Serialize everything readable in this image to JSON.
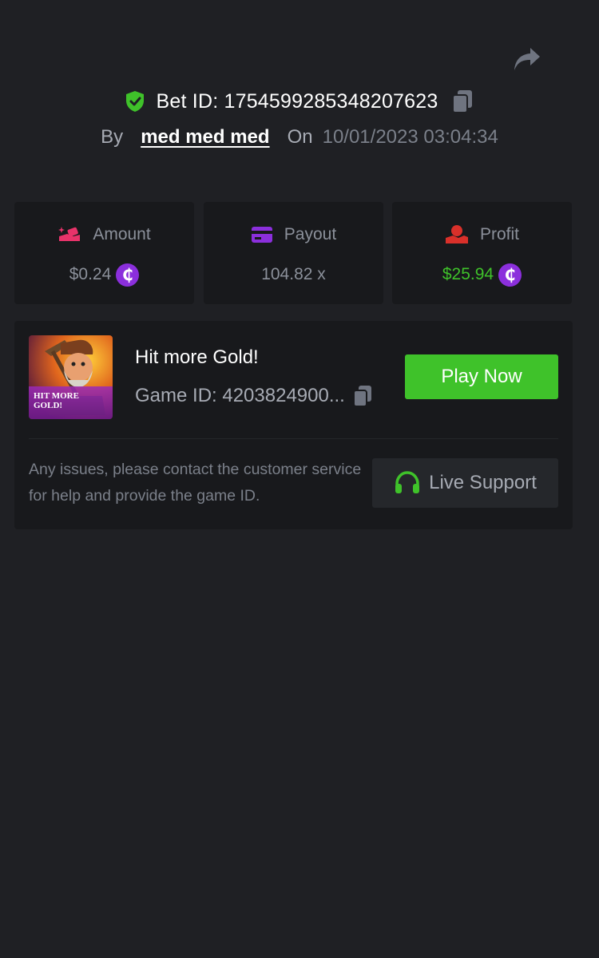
{
  "header": {
    "bet_id": "Bet ID: 1754599285348207623",
    "by_label": "By",
    "username": "med med med",
    "on_label": "On",
    "date": "10/01/2023 03:04:34"
  },
  "stats": [
    {
      "label": "Amount",
      "value": "$0.24",
      "icon": "hand-coin-icon",
      "accent": "#e8336a"
    },
    {
      "label": "Payout",
      "value": "104.82 x",
      "icon": "card-icon",
      "accent": "#8b2fdc"
    },
    {
      "label": "Profit",
      "value": "$25.94",
      "icon": "hand-money-icon",
      "accent": "#d9302a"
    }
  ],
  "currency_symbol": "₵",
  "game": {
    "title": "Hit more Gold!",
    "game_id": "Game ID: 4203824900...",
    "play_label": "Play Now",
    "thumb_text_line1": "HIT MORE",
    "thumb_text_line2": "GOLD!"
  },
  "support": {
    "help_text": "Any issues, please contact the customer service for help and provide the game ID.",
    "button_label": "Live Support"
  },
  "colors": {
    "background": "#1f2024",
    "card": "#18191c",
    "green": "#3fc22a",
    "purple": "#8b2fdc",
    "muted": "#8b909a"
  }
}
